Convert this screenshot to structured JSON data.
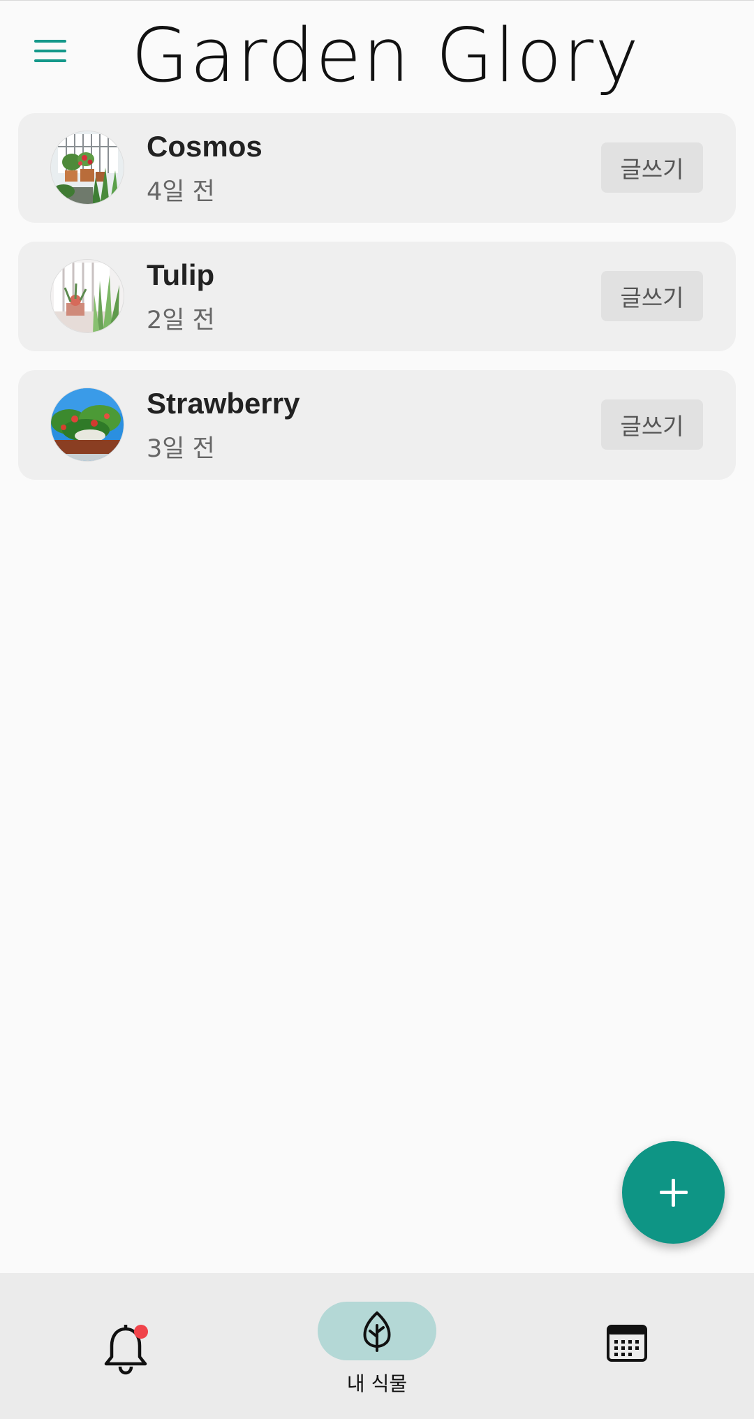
{
  "header": {
    "title": "Garden Glory",
    "menu_icon": "hamburger-menu-icon"
  },
  "plants": [
    {
      "name": "Cosmos",
      "time": "4일 전",
      "action": "글쓰기"
    },
    {
      "name": "Tulip",
      "time": "2일 전",
      "action": "글쓰기"
    },
    {
      "name": "Strawberry",
      "time": "3일 전",
      "action": "글쓰기"
    }
  ],
  "fab": {
    "icon": "plus-icon"
  },
  "bottom_nav": {
    "items": [
      {
        "icon": "bell-icon",
        "label": "",
        "has_badge": true
      },
      {
        "icon": "leaf-icon",
        "label": "내 식물",
        "selected": true
      },
      {
        "icon": "calendar-icon",
        "label": ""
      }
    ]
  },
  "colors": {
    "accent": "#0e9585",
    "selected_pill": "#b4d8d6",
    "card_bg": "#efefef",
    "badge": "#f0434a"
  }
}
